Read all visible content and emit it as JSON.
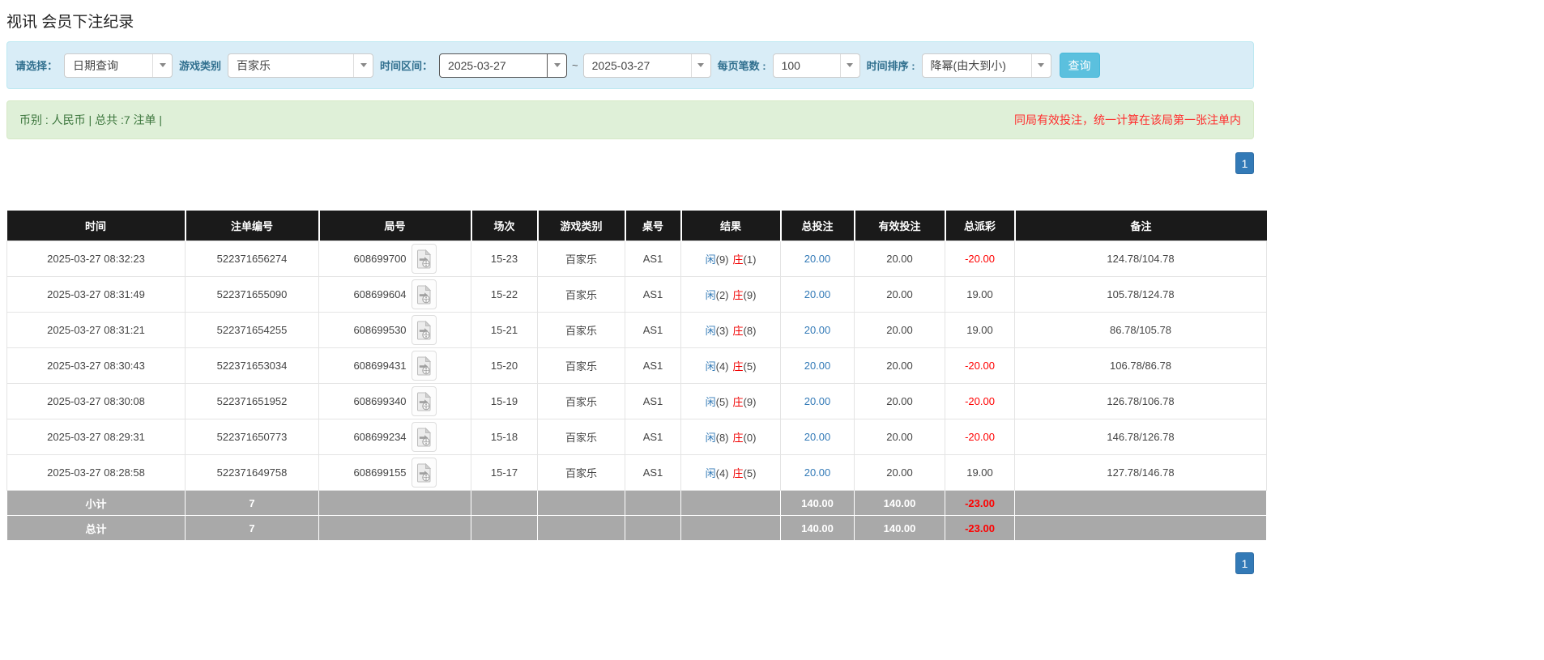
{
  "page": {
    "title": "视讯 会员下注纪录"
  },
  "colors": {
    "panel_bg": "#d9edf7",
    "panel_border": "#bce8f1",
    "label_blue": "#31708f",
    "button_bg": "#5bc0de",
    "summary_bg": "#dff0d8",
    "summary_border": "#d6e9c6",
    "summary_text": "#3c763d",
    "notice_red": "#ff2d2d",
    "negative_red": "#ff0000",
    "banker_red": "#f00000",
    "link_blue": "#337ab7",
    "header_bg": "#1a1a1a",
    "footer_bg": "#a9a9a9",
    "pagination_bg": "#337ab7",
    "pagination_border": "#2e6da4"
  },
  "filters": {
    "select_label": "请选择：",
    "select_value": "日期查询",
    "game_label": "游戏类别",
    "game_value": "百家乐",
    "range_label": "时间区间：",
    "date_from": "2025-03-27",
    "tilde": "~",
    "date_to": "2025-03-27",
    "per_page_label": "每页笔数 :",
    "per_page_value": "100",
    "sort_label": "时间排序 :",
    "sort_value": "降幂(由大到小)",
    "search_button": "查询"
  },
  "summary": {
    "left": "币别 : 人民币 | 总共 :7 注单 |",
    "notice": "同局有效投注，统一计算在该局第一张注单内"
  },
  "pagination": {
    "page": "1"
  },
  "table": {
    "headers": [
      "时间",
      "注单编号",
      "局号",
      "场次",
      "游戏类别",
      "桌号",
      "结果",
      "总投注",
      "有效投注",
      "总派彩",
      "备注"
    ],
    "result_labels": {
      "player": "闲",
      "banker": "庄"
    },
    "rows": [
      {
        "time": "2025-03-27 08:32:23",
        "bet_id": "522371656274",
        "round_id": "608699700",
        "session": "15-23",
        "game": "百家乐",
        "table_no": "AS1",
        "result_player": "(9)",
        "result_banker": "(1)",
        "total_bet": "20.00",
        "valid_bet": "20.00",
        "payout": "-20.00",
        "payout_neg": "true",
        "remark": "124.78/104.78"
      },
      {
        "time": "2025-03-27 08:31:49",
        "bet_id": "522371655090",
        "round_id": "608699604",
        "session": "15-22",
        "game": "百家乐",
        "table_no": "AS1",
        "result_player": "(2)",
        "result_banker": "(9)",
        "total_bet": "20.00",
        "valid_bet": "20.00",
        "payout": "19.00",
        "payout_neg": "false",
        "remark": "105.78/124.78"
      },
      {
        "time": "2025-03-27 08:31:21",
        "bet_id": "522371654255",
        "round_id": "608699530",
        "session": "15-21",
        "game": "百家乐",
        "table_no": "AS1",
        "result_player": "(3)",
        "result_banker": "(8)",
        "total_bet": "20.00",
        "valid_bet": "20.00",
        "payout": "19.00",
        "payout_neg": "false",
        "remark": "86.78/105.78"
      },
      {
        "time": "2025-03-27 08:30:43",
        "bet_id": "522371653034",
        "round_id": "608699431",
        "session": "15-20",
        "game": "百家乐",
        "table_no": "AS1",
        "result_player": "(4)",
        "result_banker": "(5)",
        "total_bet": "20.00",
        "valid_bet": "20.00",
        "payout": "-20.00",
        "payout_neg": "true",
        "remark": "106.78/86.78"
      },
      {
        "time": "2025-03-27 08:30:08",
        "bet_id": "522371651952",
        "round_id": "608699340",
        "session": "15-19",
        "game": "百家乐",
        "table_no": "AS1",
        "result_player": "(5)",
        "result_banker": "(9)",
        "total_bet": "20.00",
        "valid_bet": "20.00",
        "payout": "-20.00",
        "payout_neg": "true",
        "remark": "126.78/106.78"
      },
      {
        "time": "2025-03-27 08:29:31",
        "bet_id": "522371650773",
        "round_id": "608699234",
        "session": "15-18",
        "game": "百家乐",
        "table_no": "AS1",
        "result_player": "(8)",
        "result_banker": "(0)",
        "total_bet": "20.00",
        "valid_bet": "20.00",
        "payout": "-20.00",
        "payout_neg": "true",
        "remark": "146.78/126.78"
      },
      {
        "time": "2025-03-27 08:28:58",
        "bet_id": "522371649758",
        "round_id": "608699155",
        "session": "15-17",
        "game": "百家乐",
        "table_no": "AS1",
        "result_player": "(4)",
        "result_banker": "(5)",
        "total_bet": "20.00",
        "valid_bet": "20.00",
        "payout": "19.00",
        "payout_neg": "false",
        "remark": "127.78/146.78"
      }
    ],
    "subtotal": {
      "label": "小计",
      "count": "7",
      "total_bet": "140.00",
      "valid_bet": "140.00",
      "payout": "-23.00",
      "payout_neg": "true"
    },
    "total": {
      "label": "总计",
      "count": "7",
      "total_bet": "140.00",
      "valid_bet": "140.00",
      "payout": "-23.00",
      "payout_neg": "true"
    }
  }
}
